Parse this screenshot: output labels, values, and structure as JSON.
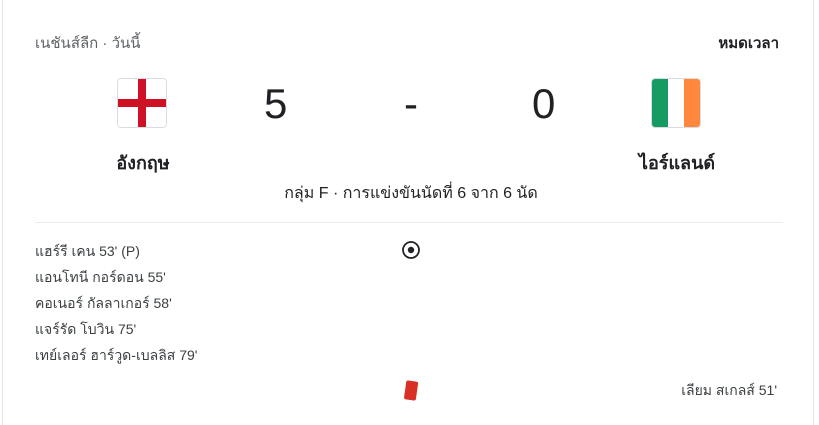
{
  "header": {
    "league": "เนชันส์ลีก · วันนี้",
    "status": "หมดเวลา"
  },
  "home": {
    "name": "อังกฤษ",
    "score": "5",
    "flag_icon": "england-flag-icon"
  },
  "away": {
    "name": "ไอร์แลนด์",
    "score": "0",
    "flag_icon": "ireland-flag-icon"
  },
  "score_separator": "-",
  "round_info": "กลุ่ม F · การแข่งขันนัดที่ 6 จาก 6 นัด",
  "home_events": [
    "แฮร์รี เคน 53' (P)",
    "แอนโทนี กอร์ดอน 55'",
    "คอเนอร์ กัลลาเกอร์ 58'",
    "แจร์รัด โบวิน 75'",
    "เทย์เลอร์ ฮาร์วูด-เบลลิส 79'"
  ],
  "away_events": [
    "เลียม สเกลส์ 51'"
  ],
  "icons": {
    "goal": "soccer-ball-icon",
    "card": "red-card-icon"
  },
  "colors": {
    "england_red": "#ce1124",
    "ireland_green": "#169b62",
    "ireland_orange": "#ff883e",
    "red_card": "#d93025"
  }
}
